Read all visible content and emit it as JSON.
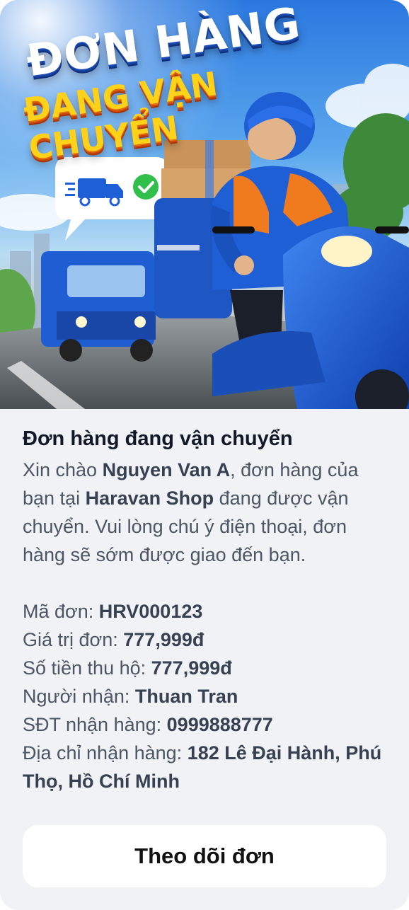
{
  "banner": {
    "headline_line1": "ĐƠN HÀNG",
    "headline_line2": "ĐANG VẬN CHUYỂN",
    "truck_icon": "delivery-truck-icon",
    "check_icon": "check-circle-icon"
  },
  "notification": {
    "title": "Đơn hàng đang vận chuyển",
    "greeting_prefix": "Xin chào ",
    "customer_name": "Nguyen Van A",
    "sentence_middle": ", đơn hàng của bạn tại ",
    "shop_name": "Haravan Shop",
    "sentence_end": " đang được vận chuyển. Vui lòng chú ý điện thoại, đơn hàng sẽ sớm được giao đến bạn."
  },
  "order": {
    "rows": [
      {
        "label": "Mã đơn: ",
        "value": "HRV000123"
      },
      {
        "label": "Giá trị đơn: ",
        "value": "777,999đ"
      },
      {
        "label": "Số tiền thu hộ: ",
        "value": "777,999đ"
      },
      {
        "label": "Người nhận: ",
        "value": "Thuan Tran"
      },
      {
        "label": "SĐT nhận hàng: ",
        "value": "0999888777"
      },
      {
        "label": "Địa chỉ nhận hàng: ",
        "value": "182 Lê Đại Hành, Phú Thọ, Hồ Chí Minh"
      }
    ]
  },
  "actions": {
    "track_label": "Theo dõi đơn"
  },
  "colors": {
    "card_bg": "#f1f2f6",
    "title": "#111827",
    "body": "#4b5563",
    "headline_white": "#ffffff",
    "headline_yellow": "#ffd21a",
    "courier_blue": "#1f5fd6",
    "courier_orange": "#f07a1e"
  }
}
